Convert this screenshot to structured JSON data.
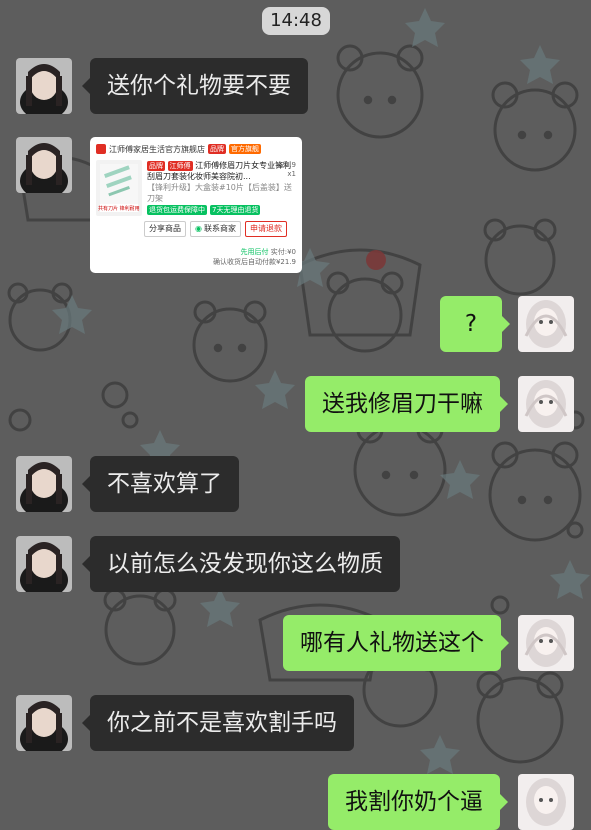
{
  "status": {
    "time": "14:48"
  },
  "messages": [
    {
      "side": "in",
      "text": "送你个礼物要不要"
    },
    {
      "side": "out",
      "text": "?"
    },
    {
      "side": "out",
      "text": "送我修眉刀干嘛"
    },
    {
      "side": "in",
      "text": "不喜欢算了"
    },
    {
      "side": "in",
      "text": "以前怎么没发现你这么物质"
    },
    {
      "side": "out",
      "text": "哪有人礼物送这个"
    },
    {
      "side": "in",
      "text": "你之前不是喜欢割手吗"
    },
    {
      "side": "out",
      "text": "我割你奶个逼"
    }
  ],
  "product_card": {
    "shop_name": "江师傅家居生活官方旗舰店",
    "shop_tags": [
      "品牌",
      "官方旗舰"
    ],
    "tag_brand": "品牌",
    "tag_name": "江师傅",
    "title": "江师傅修眉刀片女专业锋利刮眉刀套装化妆师美容院初...",
    "spec": "【锋利升级】大盒装#10片【后盖装】送刀架",
    "promo_1": "退货包运费保障中",
    "promo_2": "7天无理由退货",
    "price": "¥21.9",
    "quantity": "x1",
    "thumb_caption": "共有刀片 锋利耐用",
    "btn_share": "分享商品",
    "btn_contact": "联系商家",
    "btn_refund": "申请退款",
    "pay_note": "先用后付",
    "paid_label": "实付:",
    "paid_value": "¥0",
    "confirm_note": "确认收货后自动付款¥21.9"
  },
  "colors": {
    "background": "#5d5d5d",
    "bubble_in": "#2c2c2c",
    "bubble_out": "#95ec69",
    "accent_red": "#e02e24"
  }
}
